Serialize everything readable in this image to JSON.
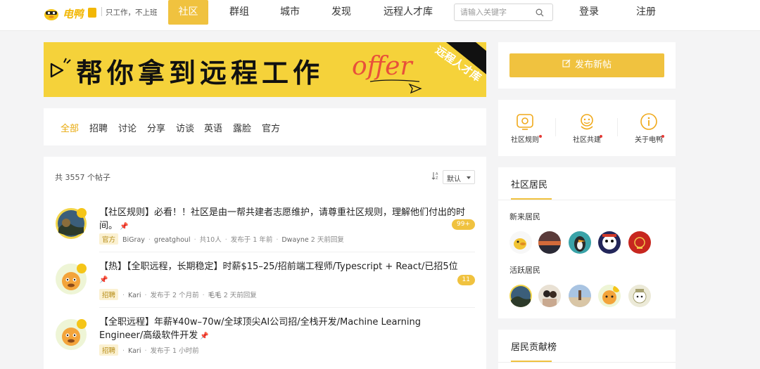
{
  "header": {
    "brand": "电鸭",
    "slogan": "只工作，不上班",
    "nav": [
      "社区",
      "群组",
      "城市",
      "发现",
      "远程人才库"
    ],
    "search_placeholder": "请输入关键字",
    "login": "登录",
    "register": "注册"
  },
  "banner": {
    "text": "帮你拿到远程工作",
    "offer": "offer",
    "ribbon": "远程人才库"
  },
  "tabs": [
    "全部",
    "招聘",
    "讨论",
    "分享",
    "访谈",
    "英语",
    "露脸",
    "官方"
  ],
  "list": {
    "count": "共 3557 个帖子",
    "sort": "默认",
    "posts": [
      {
        "title": "【社区规则】必看！！社区是由一帮共建者志愿维护，请尊重社区规则，理解他们付出的时间。",
        "tag": "官方",
        "author": "BiGray",
        "coauthor": "greatghoul",
        "people": "共10人",
        "published": "发布于 1 年前",
        "replier": "Dwayne",
        "replied": "2 天前回复",
        "replies": "99+"
      },
      {
        "title": "【热】【全职远程，长期稳定】时薪$15–25/招前端工程师/Typescript + React/已招5位",
        "tag": "招聘",
        "author": "Kari",
        "published": "发布于 2 个月前",
        "replier": "毛毛",
        "replied": "2 天前回复",
        "replies": "11"
      },
      {
        "title": "【全职远程】年薪¥40w–70w/全球顶尖AI公司招/全栈开发/Machine Learning Engineer/高级软件开发",
        "tag": "招聘",
        "author": "Kari",
        "published": "发布于 1 小时前"
      }
    ]
  },
  "sidebar": {
    "publish": "发布新帖",
    "links": [
      "社区规则",
      "社区共建",
      "关于电鸭"
    ],
    "residents_title": "社区居民",
    "new_residents": "新来居民",
    "active_residents": "活跃居民",
    "rank_title": "居民贡献榜"
  },
  "colors": {
    "accent": "#f0c23f",
    "tag_bg": "#fbf1d2",
    "banner": "#f5d23a"
  }
}
